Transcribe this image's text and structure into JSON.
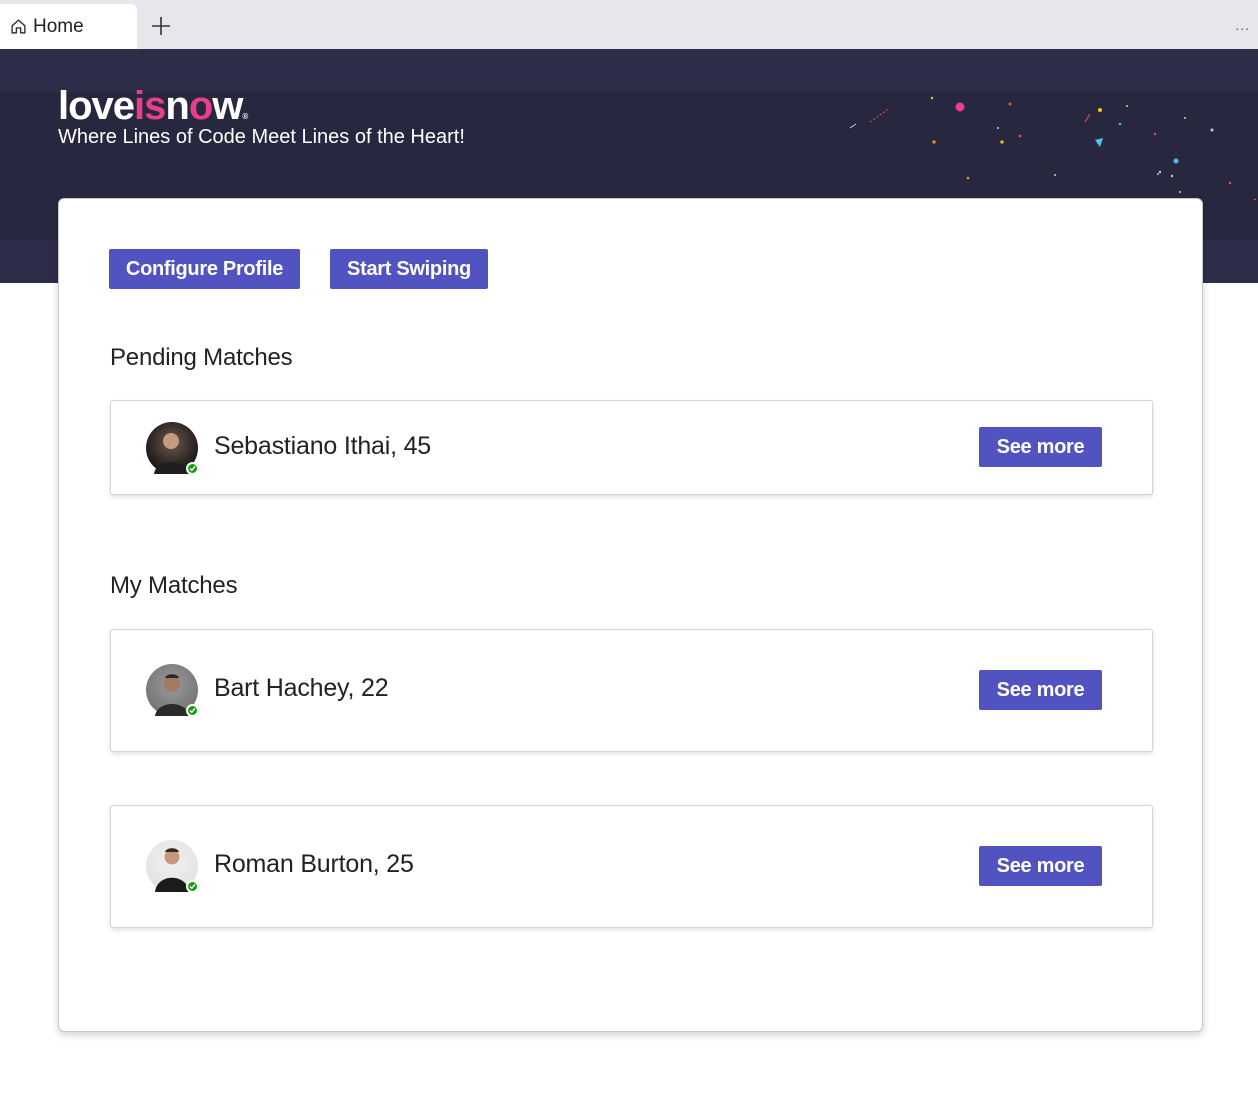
{
  "browser": {
    "tab_label": "Home",
    "tab_icon": "home-icon",
    "new_tab_icon": "plus-icon",
    "more_label": "..."
  },
  "header": {
    "logo_part1": "love",
    "logo_part2": "is",
    "logo_part3": "n",
    "logo_part4": "o",
    "logo_part5": "w",
    "logo_mark": "®",
    "tagline": "Where Lines of Code Meet Lines of the Heart!",
    "colors": {
      "background": "#2d2d49",
      "accent": "#e83e8c"
    }
  },
  "actions": {
    "configure_profile": "Configure Profile",
    "start_swiping": "Start Swiping"
  },
  "pending": {
    "title": "Pending Matches",
    "items": [
      {
        "name": "Sebastiano Ithai, 45",
        "button": "See more",
        "online": true
      }
    ]
  },
  "my_matches": {
    "title": "My Matches",
    "items": [
      {
        "name": "Bart Hachey, 22",
        "button": "See more",
        "online": true
      },
      {
        "name": "Roman Burton, 25",
        "button": "See more",
        "online": true
      }
    ]
  },
  "colors": {
    "primary": "#5153c0",
    "online": "#13a10e"
  }
}
